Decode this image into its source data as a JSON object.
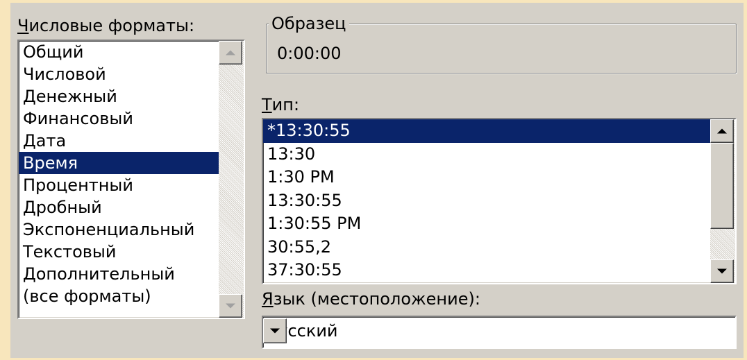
{
  "number_formats": {
    "label": "Числовые форматы:",
    "items": [
      {
        "label": "Общий",
        "selected": false
      },
      {
        "label": "Числовой",
        "selected": false
      },
      {
        "label": "Денежный",
        "selected": false
      },
      {
        "label": "Финансовый",
        "selected": false
      },
      {
        "label": "Дата",
        "selected": false
      },
      {
        "label": "Время",
        "selected": true
      },
      {
        "label": "Процентный",
        "selected": false
      },
      {
        "label": "Дробный",
        "selected": false
      },
      {
        "label": "Экспоненциальный",
        "selected": false
      },
      {
        "label": "Текстовый",
        "selected": false
      },
      {
        "label": "Дополнительный",
        "selected": false
      },
      {
        "label": "(все форматы)",
        "selected": false
      }
    ]
  },
  "sample": {
    "legend": "Образец",
    "value": "0:00:00"
  },
  "type": {
    "label": "Тип:",
    "items": [
      {
        "label": "*13:30:55",
        "selected": true
      },
      {
        "label": "13:30",
        "selected": false
      },
      {
        "label": "1:30 PM",
        "selected": false
      },
      {
        "label": "13:30:55",
        "selected": false
      },
      {
        "label": "1:30:55 PM",
        "selected": false
      },
      {
        "label": "30:55,2",
        "selected": false
      },
      {
        "label": "37:30:55",
        "selected": false
      }
    ]
  },
  "locale": {
    "label": "Язык (местоположение):",
    "value": "русский"
  },
  "colors": {
    "background": "#f8e6bc",
    "dialog": "#d4d0c8",
    "selection": "#0a246a"
  }
}
